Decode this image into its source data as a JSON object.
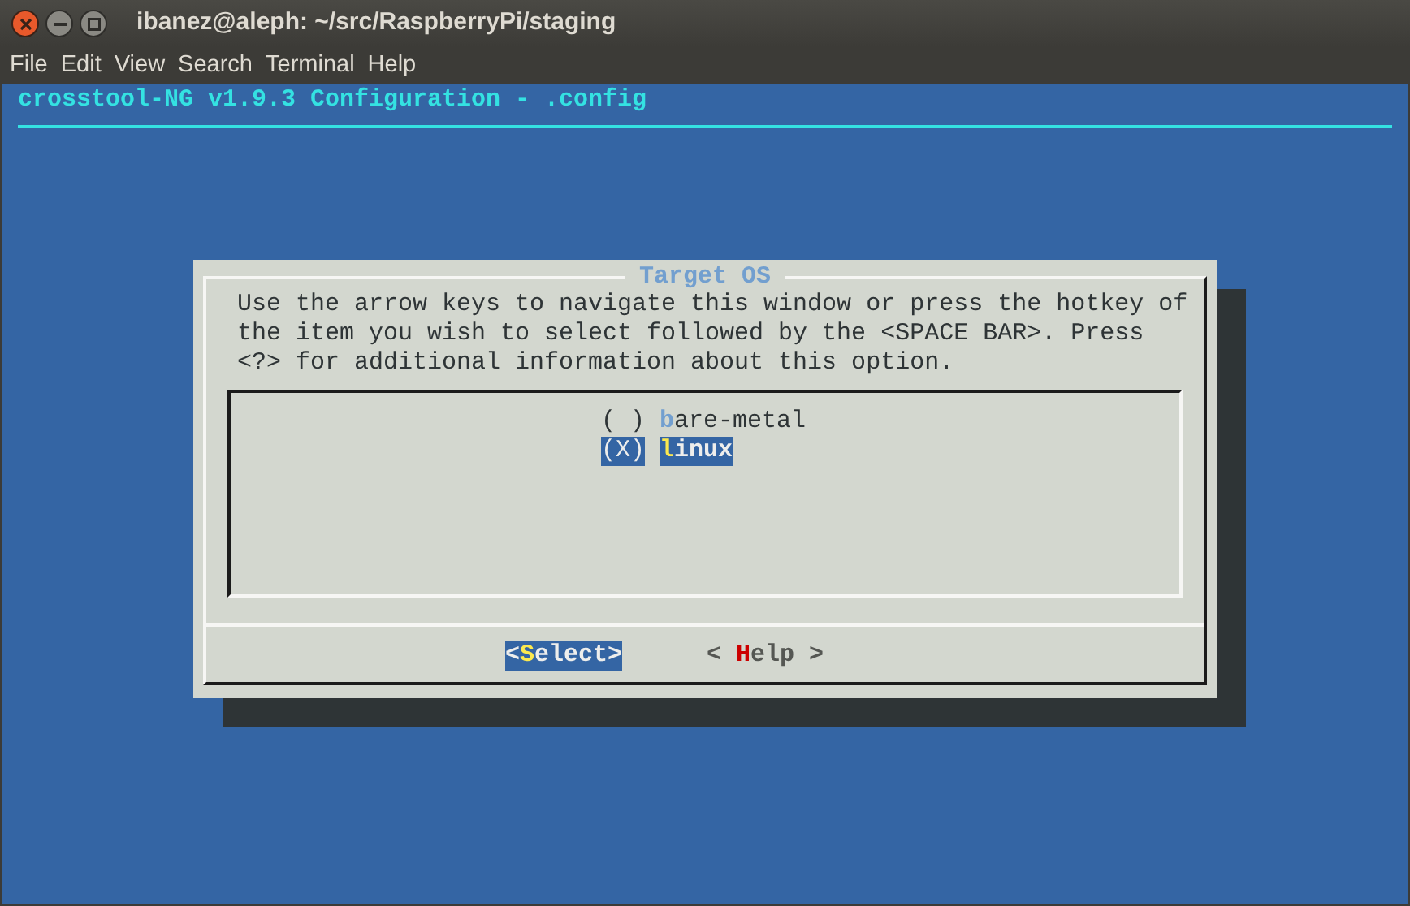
{
  "window": {
    "title": "ibanez@aleph: ~/src/RaspberryPi/staging"
  },
  "menu": [
    "File",
    "Edit",
    "View",
    "Search",
    "Terminal",
    "Help"
  ],
  "terminal": {
    "backtitle": "crosstool-NG v1.9.3 Configuration - .config"
  },
  "dialog": {
    "title": "Target OS",
    "help_lines": [
      "Use the arrow keys to navigate this window or press the hotkey of",
      "the item you wish to select followed by the <SPACE BAR>. Press",
      "<?> for additional information about this option."
    ],
    "radio_open": "(",
    "check_mark": "X",
    "radio_close": ")",
    "options": [
      {
        "hotkey": "b",
        "rest": "are-metal",
        "checked": false,
        "selected": false
      },
      {
        "hotkey": "l",
        "rest": "inux",
        "checked": true,
        "selected": true
      }
    ],
    "buttons": [
      {
        "prefix": "<",
        "hotkey": "S",
        "rest": "elect>",
        "selected": true
      },
      {
        "prefix": "< ",
        "hotkey": "H",
        "rest": "elp >",
        "selected": false
      }
    ]
  }
}
